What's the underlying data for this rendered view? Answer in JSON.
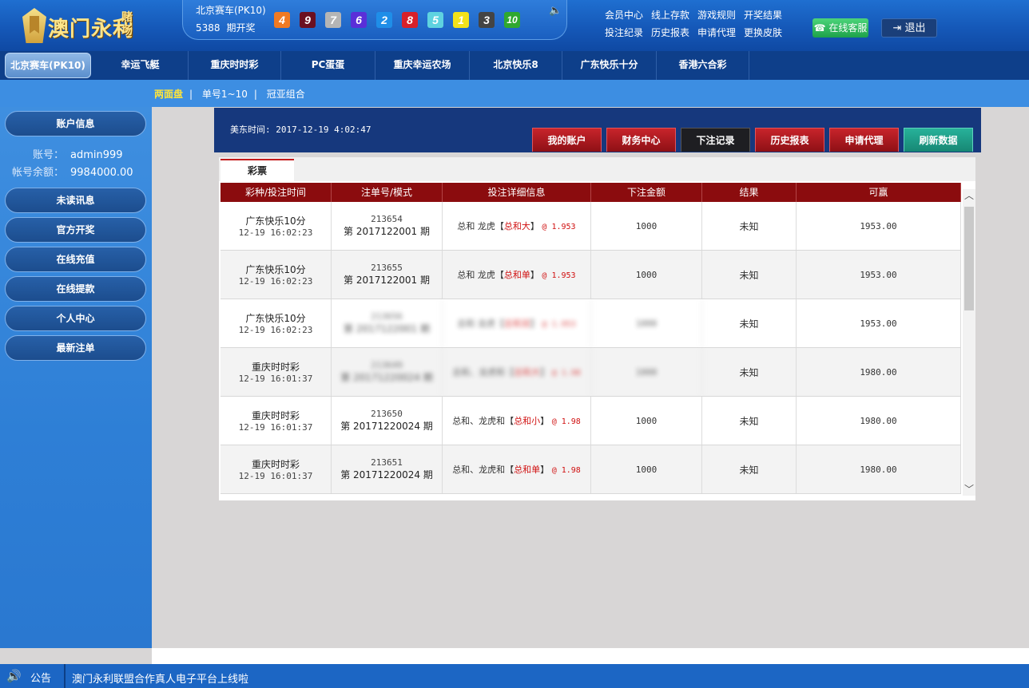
{
  "brand": {
    "name": "澳门永利",
    "suffix": "赌场"
  },
  "lottery": {
    "name": "北京赛车(PK10)",
    "period": "5388",
    "period_suffix": "期开奖",
    "balls": [
      {
        "n": "4",
        "color": "#f07a23"
      },
      {
        "n": "9",
        "color": "#6b1020"
      },
      {
        "n": "7",
        "color": "#b5b5b5"
      },
      {
        "n": "6",
        "color": "#5a2fd8"
      },
      {
        "n": "2",
        "color": "#1f8ee8"
      },
      {
        "n": "8",
        "color": "#d8202a"
      },
      {
        "n": "5",
        "color": "#5ed3e0"
      },
      {
        "n": "1",
        "color": "#f2e21a"
      },
      {
        "n": "3",
        "color": "#444444"
      },
      {
        "n": "10",
        "color": "#2fa82f"
      }
    ]
  },
  "toplinks": [
    "会员中心",
    "线上存款",
    "游戏规则",
    "开奖结果",
    "投注纪录",
    "历史报表",
    "申请代理",
    "更换皮肤"
  ],
  "buttons": {
    "service": "在线客服",
    "logout": "退出"
  },
  "nav": [
    "北京赛车(PK10)",
    "幸运飞艇",
    "重庆时时彩",
    "PC蛋蛋",
    "重庆幸运农场",
    "北京快乐8",
    "广东快乐十分",
    "香港六合彩"
  ],
  "subnav": [
    "两面盘",
    "单号1~10",
    "冠亚组合"
  ],
  "sidebar": {
    "account_info": "账户信息",
    "account_label": "账号：",
    "account_value": "admin999",
    "balance_label": "帐号余额：",
    "balance_value": "9984000.00",
    "menu": [
      "未读讯息",
      "官方开奖",
      "在线充值",
      "在线提款",
      "个人中心",
      "最新注单"
    ]
  },
  "main": {
    "time": "美东时间: 2017-12-19 4:02:47",
    "tabs": [
      "我的账户",
      "财务中心",
      "下注记录",
      "历史报表",
      "申请代理",
      "刷新数据"
    ],
    "panel_tab": "彩票",
    "columns": [
      "彩种/投注时间",
      "注单号/模式",
      "投注详细信息",
      "下注金额",
      "结果",
      "可赢"
    ],
    "rows": [
      {
        "game": "广东快乐10分",
        "time": "12-19 16:02:23",
        "no": "213654",
        "period": "第 2017122001 期",
        "detail_pre": "总和 龙虎【",
        "detail_red": "总和大",
        "detail_post": "】",
        "odds": "@ 1.953",
        "amount": "1000",
        "result": "未知",
        "win": "1953.00"
      },
      {
        "game": "广东快乐10分",
        "time": "12-19 16:02:23",
        "no": "213655",
        "period": "第 2017122001 期",
        "detail_pre": "总和 龙虎【",
        "detail_red": "总和单",
        "detail_post": "】",
        "odds": "@ 1.953",
        "amount": "1000",
        "result": "未知",
        "win": "1953.00"
      },
      {
        "game": "广东快乐10分",
        "time": "12-19 16:02:23",
        "no": "213656",
        "period": "第 2017122001 期",
        "detail_pre": "总和 龙虎【",
        "detail_red": "总和双",
        "detail_post": "】",
        "odds": "@ 1.953",
        "amount": "1000",
        "result": "未知",
        "win": "1953.00",
        "blurred": true
      },
      {
        "game": "重庆时时彩",
        "time": "12-19 16:01:37",
        "no": "213649",
        "period": "第 20171220024 期",
        "detail_pre": "总和、龙虎和【",
        "detail_red": "总和大",
        "detail_post": "】",
        "odds": "@ 1.98",
        "amount": "1000",
        "result": "未知",
        "win": "1980.00",
        "blurred": true
      },
      {
        "game": "重庆时时彩",
        "time": "12-19 16:01:37",
        "no": "213650",
        "period": "第 20171220024 期",
        "detail_pre": "总和、龙虎和【",
        "detail_red": "总和小",
        "detail_post": "】",
        "odds": "@ 1.98",
        "amount": "1000",
        "result": "未知",
        "win": "1980.00"
      },
      {
        "game": "重庆时时彩",
        "time": "12-19 16:01:37",
        "no": "213651",
        "period": "第 20171220024 期",
        "detail_pre": "总和、龙虎和【",
        "detail_red": "总和单",
        "detail_post": "】",
        "odds": "@ 1.98",
        "amount": "1000",
        "result": "未知",
        "win": "1980.00"
      }
    ]
  },
  "footer": {
    "label": "公告",
    "message": "澳门永利联盟合作真人电子平台上线啦"
  }
}
